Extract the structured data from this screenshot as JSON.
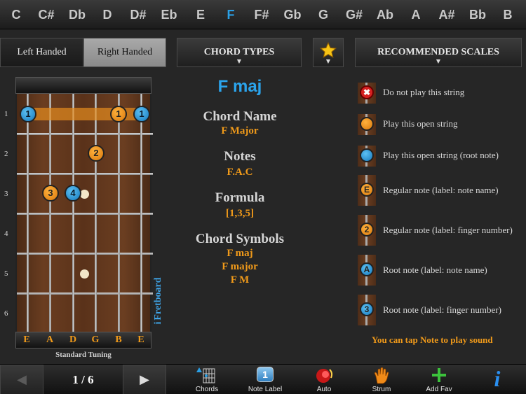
{
  "keys": [
    {
      "label": "C",
      "active": false
    },
    {
      "label": "C#",
      "active": false
    },
    {
      "label": "Db",
      "active": false
    },
    {
      "label": "D",
      "active": false
    },
    {
      "label": "D#",
      "active": false
    },
    {
      "label": "Eb",
      "active": false
    },
    {
      "label": "E",
      "active": false
    },
    {
      "label": "F",
      "active": true
    },
    {
      "label": "F#",
      "active": false
    },
    {
      "label": "Gb",
      "active": false
    },
    {
      "label": "G",
      "active": false
    },
    {
      "label": "G#",
      "active": false
    },
    {
      "label": "Ab",
      "active": false
    },
    {
      "label": "A",
      "active": false
    },
    {
      "label": "A#",
      "active": false
    },
    {
      "label": "Bb",
      "active": false
    },
    {
      "label": "B",
      "active": false
    }
  ],
  "controls": {
    "left_handed": "Left Handed",
    "right_handed": "Right Handed",
    "chord_types": "CHORD TYPES",
    "recommended_scales": "RECOMMENDED SCALES",
    "caret": "▼"
  },
  "fretboard": {
    "fret_numbers": [
      "1",
      "2",
      "3",
      "4",
      "5",
      "6"
    ],
    "strings": [
      "E",
      "A",
      "D",
      "G",
      "B",
      "E"
    ],
    "tuning": "Standard Tuning",
    "side_label": "Fretboard",
    "info_glyph": "i"
  },
  "chord": {
    "title": "F maj",
    "name_heading": "Chord Name",
    "name_value": "F Major",
    "notes_heading": "Notes",
    "notes_value": "F.A.C",
    "formula_heading": "Formula",
    "formula_value": "[1,3,5]",
    "symbols_heading": "Chord Symbols",
    "symbols": [
      "F maj",
      "F major",
      "F M"
    ]
  },
  "legend": {
    "items": [
      {
        "text": "Do not play this string",
        "icon": "x-mark-icon"
      },
      {
        "text": "Play this open string",
        "icon": "orange-dot-icon"
      },
      {
        "text": "Play this open string (root note)",
        "icon": "blue-dot-icon"
      },
      {
        "text": "Regular note (label: note name)",
        "glyph": "E"
      },
      {
        "text": "Regular note (label: finger number)",
        "glyph": "2"
      },
      {
        "text": "Root note (label: note name)",
        "glyph": "A"
      },
      {
        "text": "Root note (label: finger number)",
        "glyph": "3"
      }
    ],
    "tip": "You can tap Note to play sound"
  },
  "notes_on_board": [
    {
      "finger": "1",
      "kind": "root"
    },
    {
      "finger": "1",
      "kind": "regular"
    },
    {
      "finger": "1",
      "kind": "root"
    },
    {
      "finger": "2",
      "kind": "regular"
    },
    {
      "finger": "3",
      "kind": "regular"
    },
    {
      "finger": "4",
      "kind": "root"
    }
  ],
  "bottom": {
    "prev": "◀",
    "next": "▶",
    "page": "1 / 6",
    "tools": [
      {
        "label": "Chords",
        "icon": "chords-grid-icon"
      },
      {
        "label": "Note Label",
        "icon": "note-label-icon",
        "glyph": "1"
      },
      {
        "label": "Auto",
        "icon": "auto-play-icon"
      },
      {
        "label": "Strum",
        "icon": "strum-hand-icon"
      },
      {
        "label": "Add Fav",
        "icon": "plus-icon"
      },
      {
        "label": "",
        "icon": "info-icon",
        "glyph": "i"
      }
    ]
  },
  "colors": {
    "accent_blue": "#2aa0e6",
    "accent_orange": "#f09a1a"
  }
}
